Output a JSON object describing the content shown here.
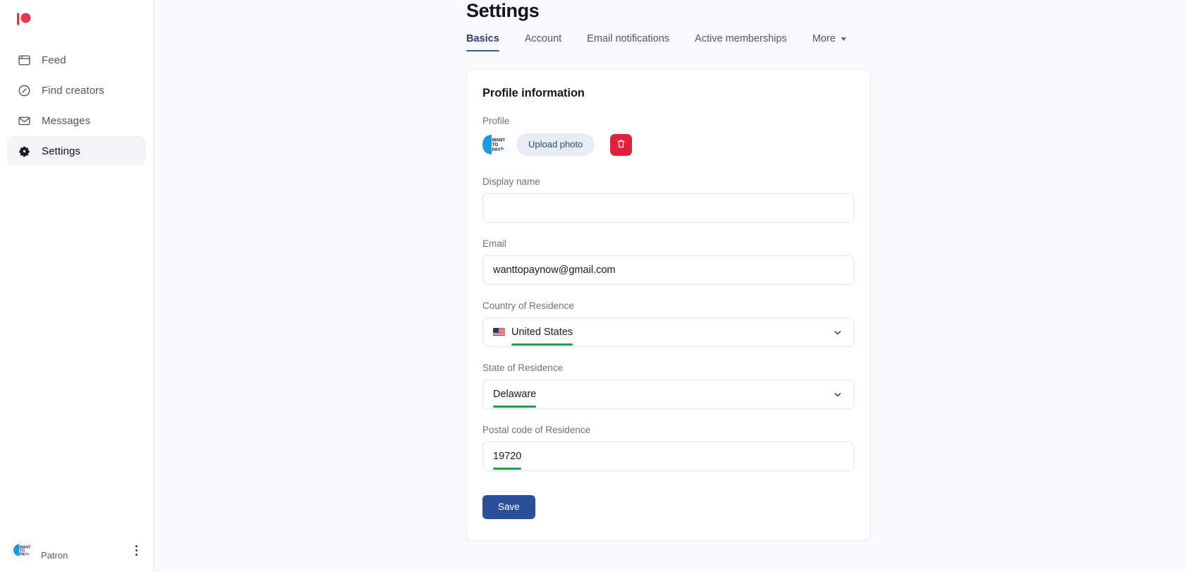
{
  "brand": {
    "logo_name": "patreon-logo",
    "logo_color": "#e4374c"
  },
  "sidebar": {
    "items": [
      {
        "label": "Feed",
        "icon": "feed-icon",
        "active": false
      },
      {
        "label": "Find creators",
        "icon": "compass-icon",
        "active": false
      },
      {
        "label": "Messages",
        "icon": "envelope-icon",
        "active": false
      },
      {
        "label": "Settings",
        "icon": "gear-icon",
        "active": true
      }
    ],
    "footer": {
      "user_label": "Patron",
      "avatar_text": "WANT TO PAY",
      "menu_icon": "kebab-menu-icon"
    }
  },
  "header": {
    "title": "Settings",
    "tabs": [
      {
        "label": "Basics",
        "active": true
      },
      {
        "label": "Account",
        "active": false
      },
      {
        "label": "Email notifications",
        "active": false
      },
      {
        "label": "Active memberships",
        "active": false
      },
      {
        "label": "More",
        "active": false,
        "has_caret": true
      }
    ]
  },
  "card": {
    "title": "Profile information",
    "profile": {
      "label": "Profile",
      "avatar_text": "WANT TO PAY",
      "upload_label": "Upload photo",
      "delete_icon": "trash-icon"
    },
    "fields": {
      "display_name": {
        "label": "Display name",
        "value": "",
        "placeholder": ""
      },
      "email": {
        "label": "Email",
        "value": "wanttopaynow@gmail.com"
      },
      "country": {
        "label": "Country of Residence",
        "value": "United States",
        "flag": "us-flag-icon",
        "highlighted": true
      },
      "state": {
        "label": "State of Residence",
        "value": "Delaware",
        "highlighted": true
      },
      "postal": {
        "label": "Postal code of Residence",
        "value": "19720",
        "highlighted": true
      }
    },
    "save_label": "Save"
  },
  "colors": {
    "accent_blue": "#2b5099",
    "danger_red": "#e0213b",
    "highlight_green": "#1fa04a",
    "tab_active": "#2c3e72",
    "page_bg": "#f8f9fc"
  }
}
